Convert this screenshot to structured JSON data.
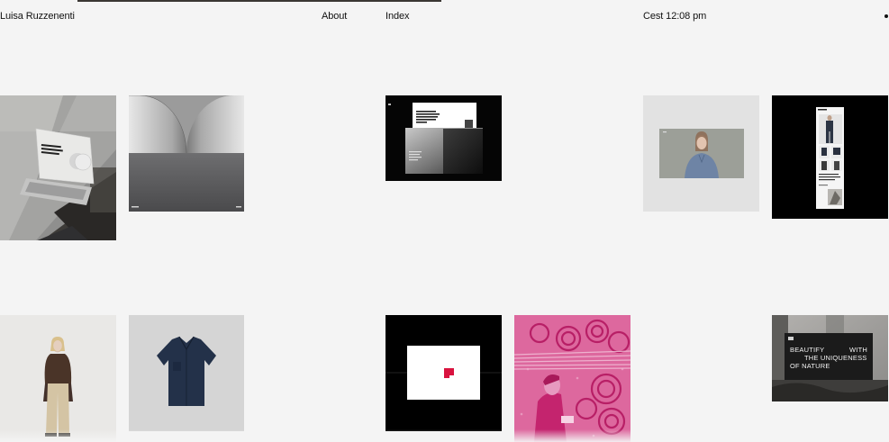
{
  "header": {
    "site_name": "Luisa Ruzzenenti",
    "about_label": "About",
    "index_label": "Index",
    "clock": "Cest 12:08 pm",
    "menu_dot_icon": "dot-icon"
  },
  "projects": {
    "tile_names": [
      "laptop-mockup",
      "gradient-arches",
      "website-mockup-black",
      "model-portrait-screen",
      "fashion-app-screens",
      "model-in-jacket",
      "navy-shirt",
      "red-logo-box",
      "pink-duotone-workers",
      "beautify-billboard"
    ],
    "beautify_text": {
      "line1_a": "BEAUTIFY",
      "line1_b": "WITH",
      "line2": "THE UNIQUENESS",
      "line3": "OF NATURE"
    }
  },
  "colors": {
    "background": "#f4f4f4",
    "text": "#111111",
    "pink": "#d9347f",
    "accent_red": "#d9133f"
  }
}
